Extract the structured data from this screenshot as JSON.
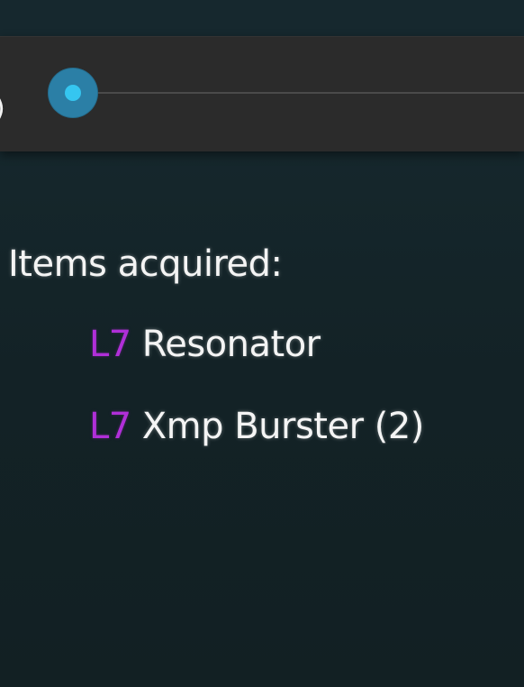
{
  "slider": {
    "clipped_label": ")",
    "value": 0,
    "accent_color": "#35c6f0",
    "thumb_color": "#2b7fa6"
  },
  "items_section": {
    "heading": "Items acquired:",
    "level_color": "#b02fd8",
    "items": [
      {
        "level": "L7",
        "name": "Resonator"
      },
      {
        "level": "L7",
        "name": "Xmp Burster (2)"
      }
    ]
  }
}
